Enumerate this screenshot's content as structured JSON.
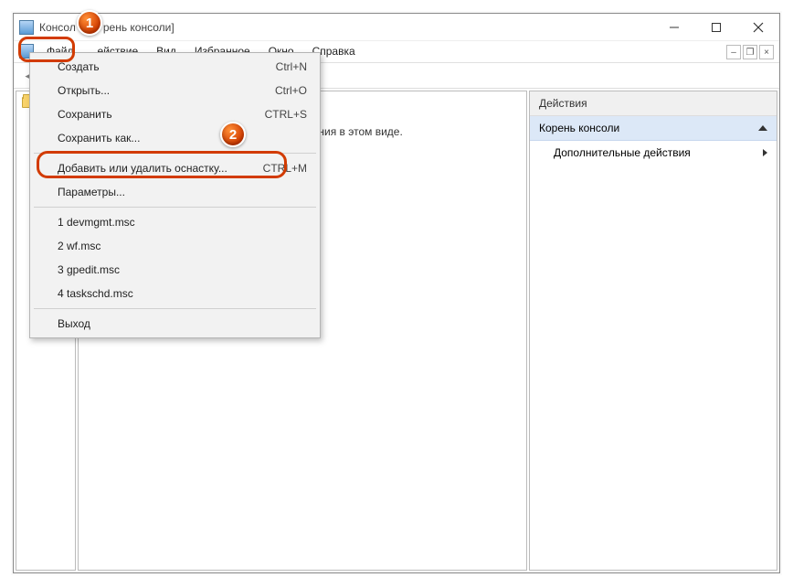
{
  "title_prefix": "Консол",
  "title_suffix": "рень консоли]",
  "menus": {
    "file": "Файл",
    "action": "ействие",
    "view": "Вид",
    "favorites": "Избранное",
    "window": "Окно",
    "help": "Справка"
  },
  "dropdown": {
    "new": "Создать",
    "new_sc": "Ctrl+N",
    "open": "Открыть...",
    "open_sc": "Ctrl+O",
    "save": "Сохранить",
    "save_sc": "CTRL+S",
    "saveas": "Сохранить как...",
    "snapin": "Добавить или удалить оснастку...",
    "snapin_sc": "CTRL+M",
    "options": "Параметры...",
    "recent1": "1 devmgmt.msc",
    "recent2": "2 wf.msc",
    "recent3": "3 gpedit.msc",
    "recent4": "4 taskschd.msc",
    "exit": "Выход"
  },
  "empty_msg": "ементов для отображения в этом виде.",
  "actions": {
    "header": "Действия",
    "root": "Корень консоли",
    "more": "Дополнительные действия"
  },
  "markers": {
    "m1": "1",
    "m2": "2"
  }
}
